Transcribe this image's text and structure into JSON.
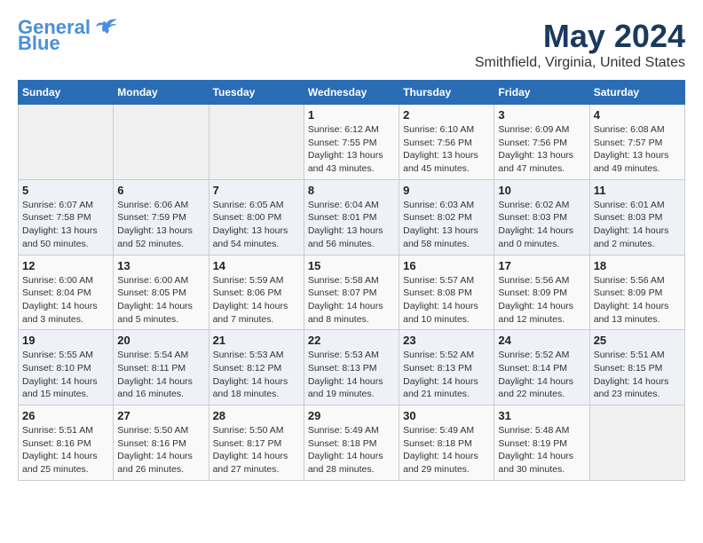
{
  "header": {
    "logo_line1": "General",
    "logo_line2": "Blue",
    "title": "May 2024",
    "subtitle": "Smithfield, Virginia, United States"
  },
  "calendar": {
    "days_of_week": [
      "Sunday",
      "Monday",
      "Tuesday",
      "Wednesday",
      "Thursday",
      "Friday",
      "Saturday"
    ],
    "weeks": [
      [
        {
          "day": "",
          "info": ""
        },
        {
          "day": "",
          "info": ""
        },
        {
          "day": "",
          "info": ""
        },
        {
          "day": "1",
          "info": "Sunrise: 6:12 AM\nSunset: 7:55 PM\nDaylight: 13 hours\nand 43 minutes."
        },
        {
          "day": "2",
          "info": "Sunrise: 6:10 AM\nSunset: 7:56 PM\nDaylight: 13 hours\nand 45 minutes."
        },
        {
          "day": "3",
          "info": "Sunrise: 6:09 AM\nSunset: 7:56 PM\nDaylight: 13 hours\nand 47 minutes."
        },
        {
          "day": "4",
          "info": "Sunrise: 6:08 AM\nSunset: 7:57 PM\nDaylight: 13 hours\nand 49 minutes."
        }
      ],
      [
        {
          "day": "5",
          "info": "Sunrise: 6:07 AM\nSunset: 7:58 PM\nDaylight: 13 hours\nand 50 minutes."
        },
        {
          "day": "6",
          "info": "Sunrise: 6:06 AM\nSunset: 7:59 PM\nDaylight: 13 hours\nand 52 minutes."
        },
        {
          "day": "7",
          "info": "Sunrise: 6:05 AM\nSunset: 8:00 PM\nDaylight: 13 hours\nand 54 minutes."
        },
        {
          "day": "8",
          "info": "Sunrise: 6:04 AM\nSunset: 8:01 PM\nDaylight: 13 hours\nand 56 minutes."
        },
        {
          "day": "9",
          "info": "Sunrise: 6:03 AM\nSunset: 8:02 PM\nDaylight: 13 hours\nand 58 minutes."
        },
        {
          "day": "10",
          "info": "Sunrise: 6:02 AM\nSunset: 8:03 PM\nDaylight: 14 hours\nand 0 minutes."
        },
        {
          "day": "11",
          "info": "Sunrise: 6:01 AM\nSunset: 8:03 PM\nDaylight: 14 hours\nand 2 minutes."
        }
      ],
      [
        {
          "day": "12",
          "info": "Sunrise: 6:00 AM\nSunset: 8:04 PM\nDaylight: 14 hours\nand 3 minutes."
        },
        {
          "day": "13",
          "info": "Sunrise: 6:00 AM\nSunset: 8:05 PM\nDaylight: 14 hours\nand 5 minutes."
        },
        {
          "day": "14",
          "info": "Sunrise: 5:59 AM\nSunset: 8:06 PM\nDaylight: 14 hours\nand 7 minutes."
        },
        {
          "day": "15",
          "info": "Sunrise: 5:58 AM\nSunset: 8:07 PM\nDaylight: 14 hours\nand 8 minutes."
        },
        {
          "day": "16",
          "info": "Sunrise: 5:57 AM\nSunset: 8:08 PM\nDaylight: 14 hours\nand 10 minutes."
        },
        {
          "day": "17",
          "info": "Sunrise: 5:56 AM\nSunset: 8:09 PM\nDaylight: 14 hours\nand 12 minutes."
        },
        {
          "day": "18",
          "info": "Sunrise: 5:56 AM\nSunset: 8:09 PM\nDaylight: 14 hours\nand 13 minutes."
        }
      ],
      [
        {
          "day": "19",
          "info": "Sunrise: 5:55 AM\nSunset: 8:10 PM\nDaylight: 14 hours\nand 15 minutes."
        },
        {
          "day": "20",
          "info": "Sunrise: 5:54 AM\nSunset: 8:11 PM\nDaylight: 14 hours\nand 16 minutes."
        },
        {
          "day": "21",
          "info": "Sunrise: 5:53 AM\nSunset: 8:12 PM\nDaylight: 14 hours\nand 18 minutes."
        },
        {
          "day": "22",
          "info": "Sunrise: 5:53 AM\nSunset: 8:13 PM\nDaylight: 14 hours\nand 19 minutes."
        },
        {
          "day": "23",
          "info": "Sunrise: 5:52 AM\nSunset: 8:13 PM\nDaylight: 14 hours\nand 21 minutes."
        },
        {
          "day": "24",
          "info": "Sunrise: 5:52 AM\nSunset: 8:14 PM\nDaylight: 14 hours\nand 22 minutes."
        },
        {
          "day": "25",
          "info": "Sunrise: 5:51 AM\nSunset: 8:15 PM\nDaylight: 14 hours\nand 23 minutes."
        }
      ],
      [
        {
          "day": "26",
          "info": "Sunrise: 5:51 AM\nSunset: 8:16 PM\nDaylight: 14 hours\nand 25 minutes."
        },
        {
          "day": "27",
          "info": "Sunrise: 5:50 AM\nSunset: 8:16 PM\nDaylight: 14 hours\nand 26 minutes."
        },
        {
          "day": "28",
          "info": "Sunrise: 5:50 AM\nSunset: 8:17 PM\nDaylight: 14 hours\nand 27 minutes."
        },
        {
          "day": "29",
          "info": "Sunrise: 5:49 AM\nSunset: 8:18 PM\nDaylight: 14 hours\nand 28 minutes."
        },
        {
          "day": "30",
          "info": "Sunrise: 5:49 AM\nSunset: 8:18 PM\nDaylight: 14 hours\nand 29 minutes."
        },
        {
          "day": "31",
          "info": "Sunrise: 5:48 AM\nSunset: 8:19 PM\nDaylight: 14 hours\nand 30 minutes."
        },
        {
          "day": "",
          "info": ""
        }
      ]
    ]
  }
}
